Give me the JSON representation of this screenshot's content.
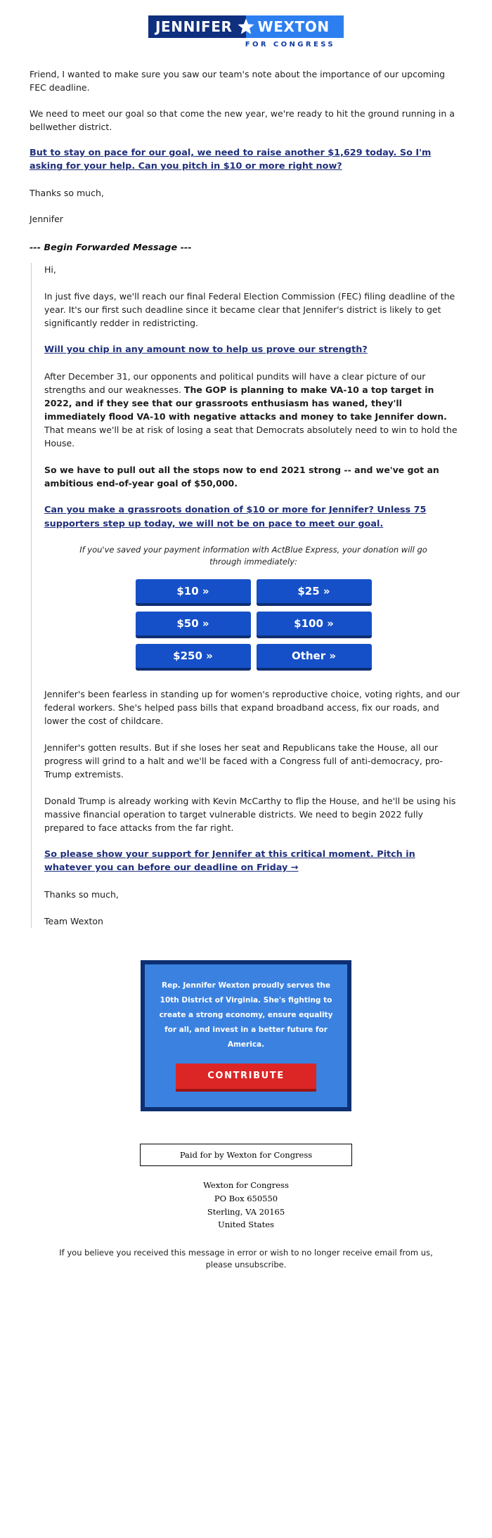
{
  "brand": {
    "logo_first_name": "JENNIFER",
    "logo_last_name": "WEXTON",
    "logo_tagline": "FOR CONGRESS",
    "star_icon": "star-icon",
    "colors": {
      "navy": "#0f2f7f",
      "bright_blue": "#2d7ff0",
      "button_blue": "#1550c8",
      "button_blue_shadow": "#0d2f73",
      "panel_blue": "#3b82e0",
      "contribute_red": "#dc2626",
      "contribute_red_shadow": "#9e1414",
      "link_navy": "#1f2f7a"
    }
  },
  "intro": {
    "paragraph_1": "Friend, I wanted to make sure you saw our team's note about the importance of our upcoming FEC deadline.",
    "paragraph_2": "We need to meet our goal so that come the new year, we're ready to hit the ground running in a bellwether district.",
    "link_1": "But to stay on pace for our goal, we need to raise another $1,629 today. So I'm asking for your help. Can you pitch in $10 or more right now?",
    "thanks": "Thanks so much,",
    "signature": "Jennifer"
  },
  "forward_divider": "--- Begin Forwarded Message ---",
  "forwarded": {
    "greeting": "Hi,",
    "paragraph_1": "In just five days, we'll reach our final Federal Election Commission (FEC) filing deadline of the year. It's our first such deadline since it became clear that Jennifer's district is likely to get significantly redder in redistricting.",
    "link_1": "Will you chip in any amount now to help us prove our strength?",
    "paragraph_2_lead": "After December 31, our opponents and political pundits will have a clear picture of our strengths and our weaknesses. ",
    "paragraph_2_bold": "The GOP is planning to make VA-10 a top target in 2022, and if they see that our grassroots enthusiasm has waned, they'll immediately flood VA-10 with negative attacks and money to take Jennifer down.",
    "paragraph_2_tail": " That means we'll be at risk of losing a seat that Democrats absolutely need to win to hold the House.",
    "paragraph_3_bold": "So we have to pull out all the stops now to end 2021 strong -- and we've got an ambitious end-of-year goal of $50,000.",
    "link_2": "Can you make a grassroots donation of $10 or more for Jennifer? Unless 75 supporters step up today, we will not be on pace to meet our goal.",
    "actblue_note": "If you've saved your payment information with ActBlue Express, your donation will go through immediately:",
    "paragraph_4": "Jennifer's been fearless in standing up for women's reproductive choice, voting rights, and our federal workers. She's helped pass bills that expand broadband access, fix our roads, and lower the cost of childcare.",
    "paragraph_5": "Jennifer's gotten results. But if she loses her seat and Republicans take the House, all our progress will grind to a halt and we'll be faced with a Congress full of anti-democracy, pro-Trump extremists.",
    "paragraph_6": "Donald Trump is already working with Kevin McCarthy to flip the House, and he'll be using his massive financial operation to target vulnerable districts. We need to begin 2022 fully prepared to face attacks from the far right.",
    "link_3": "So please show your support for Jennifer at this critical moment. Pitch in whatever you can before our deadline on Friday →",
    "thanks": "Thanks so much,",
    "signature": "Team Wexton"
  },
  "donation_buttons": [
    {
      "label": "$10 »",
      "amount": "10"
    },
    {
      "label": "$25 »",
      "amount": "25"
    },
    {
      "label": "$50 »",
      "amount": "50"
    },
    {
      "label": "$100 »",
      "amount": "100"
    },
    {
      "label": "$250 »",
      "amount": "250"
    },
    {
      "label": "Other »",
      "amount": "other"
    }
  ],
  "contribute_panel": {
    "text": "Rep. Jennifer Wexton proudly serves the 10th District of Virginia. She's fighting to create a strong economy, ensure equality for all, and invest in a better future for America.",
    "button_label": "CONTRIBUTE"
  },
  "footer": {
    "paid_for": "Paid for by Wexton for Congress",
    "address_lines": [
      "Wexton for Congress",
      "PO Box 650550",
      "Sterling, VA 20165",
      "United States"
    ],
    "unsubscribe_text_before": "If you believe you received this message in error or wish to no longer receive email from us, please ",
    "unsubscribe_link": "unsubscribe",
    "unsubscribe_text_after": "."
  }
}
